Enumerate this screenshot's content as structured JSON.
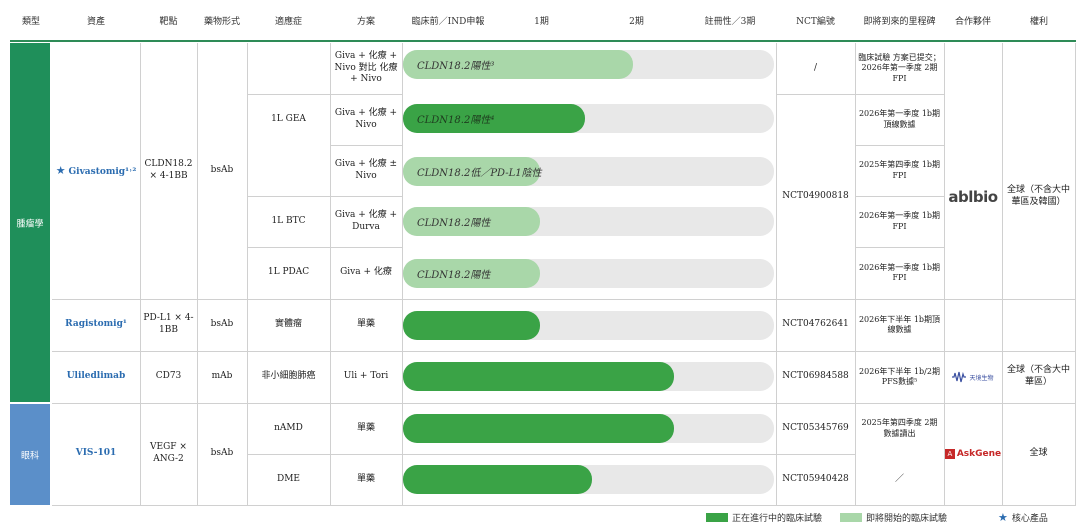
{
  "headers": {
    "type": "類型",
    "asset": "資產",
    "target": "靶點",
    "modality": "藥物形式",
    "indication": "適應症",
    "regimen": "方案",
    "preclinical": "臨床前／IND申報",
    "phase1": "1期",
    "phase2": "2期",
    "phase3": "註冊性／3期",
    "nct": "NCT編號",
    "milestone": "即將到來的里程碑",
    "partner": "合作夥伴",
    "rights": "權利"
  },
  "categories": {
    "oncology": "腫瘤學",
    "ophthalmology": "眼科"
  },
  "assets": {
    "givastomig": "Givastomig¹˒²",
    "ragistomig": "Ragistomig¹",
    "uliledlimab": "Uliledlimab",
    "vis101": "VIS-101"
  },
  "targets": {
    "givastomig": "CLDN18.2 × 4-1BB",
    "ragistomig": "PD-L1 × 4-1BB",
    "uliledlimab": "CD73",
    "vis101": "VEGF × ANG-2"
  },
  "modalities": {
    "givastomig": "bsAb",
    "ragistomig": "bsAb",
    "uliledlimab": "mAb",
    "vis101": "bsAb"
  },
  "indications": {
    "gea": "1L GEA",
    "btc": "1L BTC",
    "pdac": "1L PDAC",
    "solid": "實體瘤",
    "nsclc": "非小細胞肺癌",
    "namd": "nAMD",
    "dme": "DME"
  },
  "regimens": {
    "r1": "Giva + 化療 + Nivo 對比 化療 + Nivo",
    "r2": "Giva + 化療 + Nivo",
    "r3": "Giva + 化療 ± Nivo",
    "r4": "Giva + 化療 + Durva",
    "r5": "Giva + 化療",
    "r6": "單藥",
    "r7": "Uli + Tori",
    "r8": "單藥",
    "r9": "單藥"
  },
  "bar_labels": {
    "b1": "CLDN18.2陽性³",
    "b2": "CLDN18.2陽性⁴",
    "b3": "CLDN18.2低／PD-L1陰性",
    "b4": "CLDN18.2陽性",
    "b5": "CLDN18.2陽性"
  },
  "progress": {
    "b1": 0.62,
    "b2": 0.49,
    "b3": 0.37,
    "b4": 0.37,
    "b5": 0.37,
    "b6": 0.37,
    "b7": 0.73,
    "b8": 0.73,
    "b9": 0.51
  },
  "nct": {
    "n1": "/",
    "giva": "NCT04900818",
    "ragi": "NCT04762641",
    "uli": "NCT06984588",
    "namd": "NCT05345769",
    "dme": "NCT05940428"
  },
  "milestones": {
    "m1": "臨床試驗 方案已提交；2026年第一季度 2期FPI",
    "m2": "2026年第一季度 1b期頂線數據",
    "m3": "2025年第四季度 1b期FPI",
    "m4": "2026年第一季度 1b期FPI",
    "m5": "2026年第一季度 1b期FPI",
    "m6": "2026年下半年 1b期頂線數據",
    "m7": "2026年下半年 1b/2期PFS數據⁵",
    "m8": "2025年第四季度 2期 數據讀出",
    "m9": "／"
  },
  "partners": {
    "abl": "ablbio",
    "tianjing": "天境生物",
    "askgene": "AskGene"
  },
  "rights": {
    "giva": "全球（不含大中華區及韓國）",
    "uli": "全球（不含大中華區）",
    "vis": "全球"
  },
  "legend": {
    "ongoing": "正在進行中的臨床試驗",
    "upcoming": "即將開始的臨床試驗",
    "core": "核心產品"
  },
  "colors": {
    "ongoing": "#3aa346",
    "upcoming": "#a9d7a9",
    "oncology": "#1f8f5a",
    "ophthalmology": "#5b8fc9",
    "accent": "#2b6cb0"
  }
}
